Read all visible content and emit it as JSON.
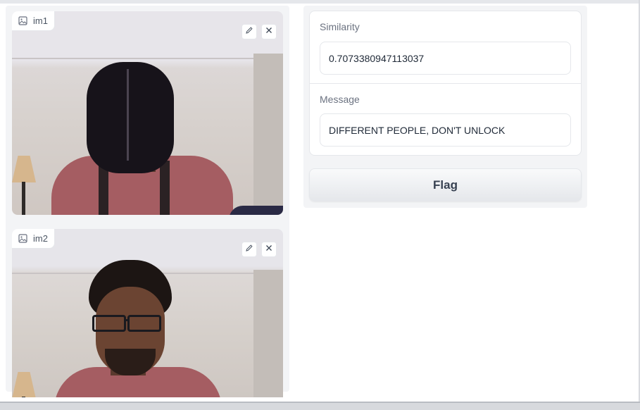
{
  "inputs": {
    "image1": {
      "label": "im1"
    },
    "image2": {
      "label": "im2"
    }
  },
  "outputs": {
    "similarity": {
      "label": "Similarity",
      "value": "0.7073380947113037"
    },
    "message": {
      "label": "Message",
      "value": "DIFFERENT PEOPLE, DON'T UNLOCK"
    }
  },
  "actions": {
    "flag_label": "Flag"
  },
  "icons": {
    "image": "image-icon",
    "edit": "pencil-icon",
    "clear": "close-icon"
  },
  "colors": {
    "panel_bg": "#f3f4f6",
    "border": "#e5e7eb",
    "label_text": "#6b7280"
  }
}
